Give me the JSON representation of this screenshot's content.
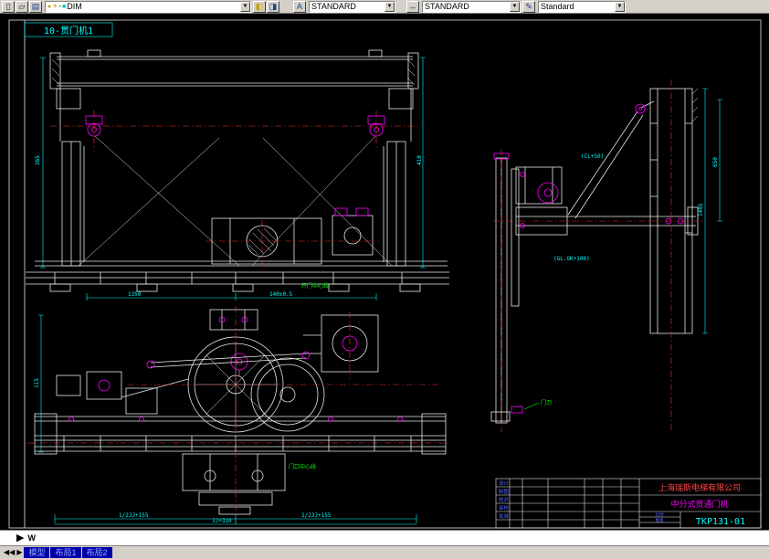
{
  "colors": {
    "canvas_bg": "#000000",
    "line": "#e8e8e8",
    "dimension": "#00ffff",
    "detail": "#ff00ff",
    "centerline": "#ff2a2a",
    "annotation": "#00ff00",
    "titleblock_company": "#ff4444",
    "tab_highlight": "#0000a8"
  },
  "icons": {
    "new_file": "▯",
    "open_file": "▱",
    "layers": "▤",
    "layer_make": "◧",
    "layer_prev": "◨",
    "text_style": "A",
    "dim_style": "↔",
    "style_mgr": "✎",
    "bulb": "●",
    "sun": "☀",
    "lock": "▪",
    "swatch": "■",
    "combo_arrow": "▼",
    "ucs_triangle": "▶",
    "tab_prev": "◀◀",
    "tab_next": "▶"
  },
  "toolbar": {
    "layer_combo_value": "DIM",
    "text_style_value": "STANDARD",
    "dim_style_value": "STANDARD",
    "current_style_value": "Standard"
  },
  "sheet": {
    "view_label": "10-贯门机1"
  },
  "front_view": {
    "dim_left": "365",
    "dim_right": "410",
    "dim_bottom_1": "1350",
    "dim_bottom_2": "140±0.5",
    "label_center": "开门中心线"
  },
  "plan_view": {
    "dim_left": "115",
    "dim_b1": "1/2JJ+155",
    "dim_b2": "1/2JJ+155",
    "dim_total": "JJ+310",
    "label_center": "门口中心线"
  },
  "side_view": {
    "dim_1": "1405",
    "dim_2": "650",
    "note_1": "(CL+50)",
    "note_2": "(GL.GK+100)",
    "label_vane": "门刀"
  },
  "title_block": {
    "company": "上海瑞斯电梯有限公司",
    "drawing_title": "中分式贯通门机",
    "drawing_number": "TKP131-01",
    "rows": [
      "设计",
      "制图",
      "校对",
      "审核",
      "批准"
    ],
    "cell_scale": "比例",
    "cell_qty": "数量"
  },
  "status": {
    "ucs_letter": "W",
    "tabs": [
      "模型",
      "布局1",
      "布局2"
    ]
  }
}
